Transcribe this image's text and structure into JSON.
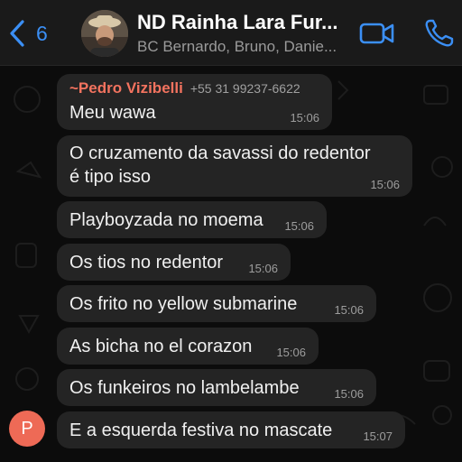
{
  "header": {
    "back_count": "6",
    "title": "ND Rainha Lara Fur...",
    "subtitle": "BC Bernardo, Bruno, Danie..."
  },
  "messages": [
    {
      "sender_name": "~Pedro Vizibelli",
      "sender_phone": "+55 31 99237-6622",
      "text": "Meu wawa",
      "time": "15:06"
    },
    {
      "text_line1": "O cruzamento da savassi do redentor",
      "text_line2": "é tipo isso",
      "time": "15:06"
    },
    {
      "text": "Playboyzada no moema",
      "time": "15:06"
    },
    {
      "text": "Os tios no redentor",
      "time": "15:06"
    },
    {
      "text": "Os frito no yellow submarine",
      "time": "15:06"
    },
    {
      "text": "As bicha no el corazon",
      "time": "15:06"
    },
    {
      "text": "Os funkeiros no lambelambe",
      "time": "15:06"
    },
    {
      "text": "E a esquerda festiva no mascate",
      "time": "15:07"
    }
  ],
  "sender_avatar": {
    "initial": "P",
    "color": "#ee6a56"
  },
  "icons": {
    "back": "chevron-left-icon",
    "video": "video-camera-icon",
    "phone": "phone-icon"
  },
  "colors": {
    "accent": "#3b8ff5",
    "bubble": "#242424",
    "sender_name": "#f3735f",
    "header_bg": "#1a1a1a"
  }
}
